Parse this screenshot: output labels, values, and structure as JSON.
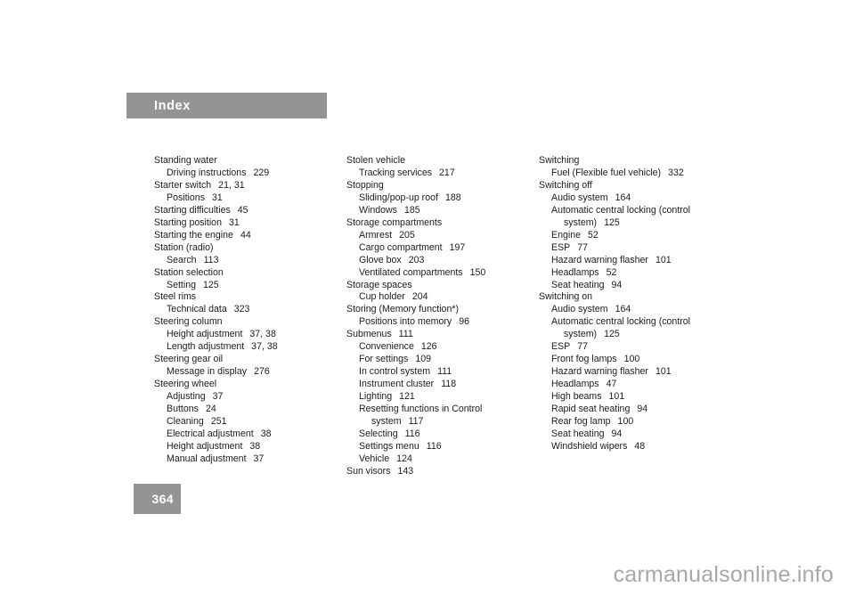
{
  "header": {
    "title": "Index",
    "band_color": "#949494"
  },
  "page_number": {
    "value": "364",
    "box_color": "#949494"
  },
  "watermark": {
    "text": "carmanualsonline.info",
    "color": "#a8a8a8"
  },
  "columns": [
    {
      "name": "column-1",
      "entries": [
        {
          "level": 0,
          "text": "Standing water",
          "page": ""
        },
        {
          "level": 1,
          "text": "Driving instructions",
          "page": "229"
        },
        {
          "level": 0,
          "text": "Starter switch",
          "page": "21, 31"
        },
        {
          "level": 1,
          "text": "Positions",
          "page": "31"
        },
        {
          "level": 0,
          "text": "Starting difficulties",
          "page": "45"
        },
        {
          "level": 0,
          "text": "Starting position",
          "page": "31"
        },
        {
          "level": 0,
          "text": "Starting the engine",
          "page": "44"
        },
        {
          "level": 0,
          "text": "Station (radio)",
          "page": ""
        },
        {
          "level": 1,
          "text": "Search",
          "page": "113"
        },
        {
          "level": 0,
          "text": "Station selection",
          "page": ""
        },
        {
          "level": 1,
          "text": "Setting",
          "page": "125"
        },
        {
          "level": 0,
          "text": "Steel rims",
          "page": ""
        },
        {
          "level": 1,
          "text": "Technical data",
          "page": "323"
        },
        {
          "level": 0,
          "text": "Steering column",
          "page": ""
        },
        {
          "level": 1,
          "text": "Height adjustment",
          "page": "37, 38"
        },
        {
          "level": 1,
          "text": "Length adjustment",
          "page": "37, 38"
        },
        {
          "level": 0,
          "text": "Steering gear oil",
          "page": ""
        },
        {
          "level": 1,
          "text": "Message in display",
          "page": "276"
        },
        {
          "level": 0,
          "text": "Steering wheel",
          "page": ""
        },
        {
          "level": 1,
          "text": "Adjusting",
          "page": "37"
        },
        {
          "level": 1,
          "text": "Buttons",
          "page": "24"
        },
        {
          "level": 1,
          "text": "Cleaning",
          "page": "251"
        },
        {
          "level": 1,
          "text": "Electrical adjustment",
          "page": "38"
        },
        {
          "level": 1,
          "text": "Height adjustment",
          "page": "38"
        },
        {
          "level": 1,
          "text": "Manual adjustment",
          "page": "37"
        }
      ]
    },
    {
      "name": "column-2",
      "entries": [
        {
          "level": 0,
          "text": "Stolen vehicle",
          "page": ""
        },
        {
          "level": 1,
          "text": "Tracking services",
          "page": "217"
        },
        {
          "level": 0,
          "text": "Stopping",
          "page": ""
        },
        {
          "level": 1,
          "text": "Sliding/pop-up roof",
          "page": "188"
        },
        {
          "level": 1,
          "text": "Windows",
          "page": "185"
        },
        {
          "level": 0,
          "text": "Storage compartments",
          "page": ""
        },
        {
          "level": 1,
          "text": "Armrest",
          "page": "205"
        },
        {
          "level": 1,
          "text": "Cargo compartment",
          "page": "197"
        },
        {
          "level": 1,
          "text": "Glove box",
          "page": "203"
        },
        {
          "level": 1,
          "text": "Ventilated compartments",
          "page": "150"
        },
        {
          "level": 0,
          "text": "Storage spaces",
          "page": ""
        },
        {
          "level": 1,
          "text": "Cup holder",
          "page": "204"
        },
        {
          "level": 0,
          "text": "Storing (Memory function*)",
          "page": ""
        },
        {
          "level": 1,
          "text": "Positions into memory",
          "page": "96"
        },
        {
          "level": 0,
          "text": "Submenus",
          "page": "111"
        },
        {
          "level": 1,
          "text": "Convenience",
          "page": "126"
        },
        {
          "level": 1,
          "text": "For settings",
          "page": "109"
        },
        {
          "level": 1,
          "text": "In control system",
          "page": "111"
        },
        {
          "level": 1,
          "text": "Instrument cluster",
          "page": "118"
        },
        {
          "level": 1,
          "text": "Lighting",
          "page": "121"
        },
        {
          "level": 1,
          "text": "Resetting functions in Control",
          "page": ""
        },
        {
          "level": 2,
          "text": "system",
          "page": "117"
        },
        {
          "level": 1,
          "text": "Selecting",
          "page": "116"
        },
        {
          "level": 1,
          "text": "Settings menu",
          "page": "116"
        },
        {
          "level": 1,
          "text": "Vehicle",
          "page": "124"
        },
        {
          "level": 0,
          "text": "Sun visors",
          "page": "143"
        }
      ]
    },
    {
      "name": "column-3",
      "entries": [
        {
          "level": 0,
          "text": "Switching",
          "page": ""
        },
        {
          "level": 1,
          "text": "Fuel (Flexible fuel vehicle)",
          "page": "332"
        },
        {
          "level": 0,
          "text": "Switching off",
          "page": ""
        },
        {
          "level": 1,
          "text": "Audio system",
          "page": "164"
        },
        {
          "level": 1,
          "text": "Automatic central locking (control",
          "page": ""
        },
        {
          "level": 2,
          "text": "system)",
          "page": "125"
        },
        {
          "level": 1,
          "text": "Engine",
          "page": "52"
        },
        {
          "level": 1,
          "text": "ESP",
          "page": "77"
        },
        {
          "level": 1,
          "text": "Hazard warning flasher",
          "page": "101"
        },
        {
          "level": 1,
          "text": "Headlamps",
          "page": "52"
        },
        {
          "level": 1,
          "text": "Seat heating",
          "page": "94"
        },
        {
          "level": 0,
          "text": "Switching on",
          "page": ""
        },
        {
          "level": 1,
          "text": "Audio system",
          "page": "164"
        },
        {
          "level": 1,
          "text": "Automatic central locking (control",
          "page": ""
        },
        {
          "level": 2,
          "text": "system)",
          "page": "125"
        },
        {
          "level": 1,
          "text": "ESP",
          "page": "77"
        },
        {
          "level": 1,
          "text": "Front fog lamps",
          "page": "100"
        },
        {
          "level": 1,
          "text": "Hazard warning flasher",
          "page": "101"
        },
        {
          "level": 1,
          "text": "Headlamps",
          "page": "47"
        },
        {
          "level": 1,
          "text": "High beams",
          "page": "101"
        },
        {
          "level": 1,
          "text": "Rapid seat heating",
          "page": "94"
        },
        {
          "level": 1,
          "text": "Rear fog lamp",
          "page": "100"
        },
        {
          "level": 1,
          "text": "Seat heating",
          "page": "94"
        },
        {
          "level": 1,
          "text": "Windshield wipers",
          "page": "48"
        }
      ]
    }
  ]
}
